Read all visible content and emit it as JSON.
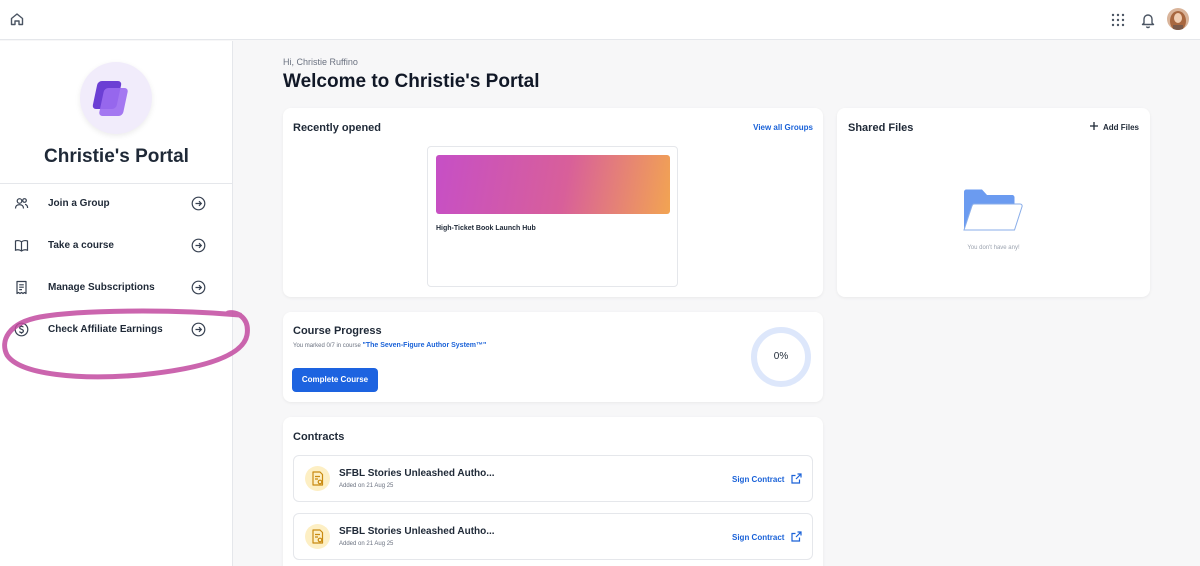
{
  "topbar": {
    "home_icon": "home-icon",
    "apps_icon": "apps-grid-icon",
    "notification_icon": "bell-icon",
    "avatar": "user-avatar"
  },
  "sidebar": {
    "portal_name": "Christie's Portal",
    "items": [
      {
        "label": "Join a Group",
        "icon": "users-icon"
      },
      {
        "label": "Take a course",
        "icon": "book-icon"
      },
      {
        "label": "Manage Subscriptions",
        "icon": "receipt-icon"
      },
      {
        "label": "Check Affiliate Earnings",
        "icon": "dollar-circle-icon"
      }
    ],
    "annotation_color": "#c24aa0"
  },
  "header": {
    "greeting": "Hi, Christie Ruffino",
    "title": "Welcome to Christie's Portal"
  },
  "recent": {
    "title": "Recently opened",
    "view_all": "View all Groups",
    "group_name": "High-Ticket Book Launch Hub"
  },
  "shared_files": {
    "title": "Shared Files",
    "add_label": "Add Files",
    "empty_text": "You don't have any!"
  },
  "course_progress": {
    "title": "Course Progress",
    "marked_text": "You marked 0/7 in course",
    "course_name": "\"The Seven-Figure Author System™\"",
    "button": "Complete Course",
    "percent_label": "0%",
    "percent": 0
  },
  "contracts": {
    "title": "Contracts",
    "items": [
      {
        "name": "SFBL Stories Unleashed Autho...",
        "date": "Added on 21 Aug 25",
        "action": "Sign Contract"
      },
      {
        "name": "SFBL Stories Unleashed Autho...",
        "date": "Added on 21 Aug 25",
        "action": "Sign Contract"
      }
    ]
  },
  "colors": {
    "primary": "#1d63e0",
    "link": "#1a62d8",
    "progress_ring": "#dde7fb"
  }
}
